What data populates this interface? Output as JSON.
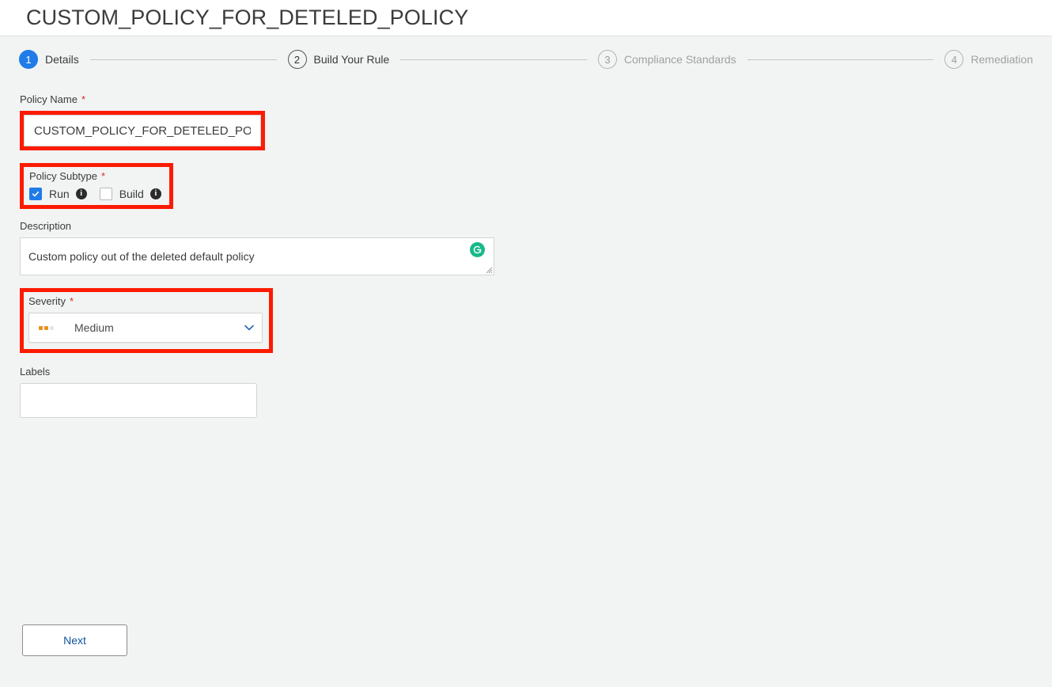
{
  "header": {
    "title": "CUSTOM_POLICY_FOR_DETELED_POLICY"
  },
  "stepper": {
    "steps": [
      {
        "number": "1",
        "label": "Details",
        "state": "active"
      },
      {
        "number": "2",
        "label": "Build Your Rule",
        "state": "current"
      },
      {
        "number": "3",
        "label": "Compliance Standards",
        "state": "inactive"
      },
      {
        "number": "4",
        "label": "Remediation",
        "state": "inactive"
      }
    ]
  },
  "form": {
    "policy_name": {
      "label": "Policy Name",
      "required_marker": "*",
      "value": "CUSTOM_POLICY_FOR_DETELED_POLICY",
      "placeholder": ""
    },
    "policy_subtype": {
      "label": "Policy Subtype",
      "required_marker": "*",
      "options": [
        {
          "label": "Run",
          "checked": true,
          "info": "info-icon"
        },
        {
          "label": "Build",
          "checked": false,
          "info": "info-icon"
        }
      ]
    },
    "description": {
      "label": "Description",
      "value": "Custom policy out of the deleted default policy",
      "placeholder": "",
      "badge_icon": "grammarly-icon"
    },
    "severity": {
      "label": "Severity",
      "required_marker": "*",
      "value": "Medium",
      "dots_filled": 2,
      "dots_total": 3,
      "chevron": "chevron-down-icon"
    },
    "labels": {
      "label": "Labels",
      "value": "",
      "placeholder": ""
    }
  },
  "footer": {
    "next_label": "Next"
  },
  "colors": {
    "accent_blue": "#1f7ce8",
    "highlight_red": "#fc1b00",
    "severity_orange": "#e8921a",
    "grammar_green": "#17b98a",
    "link_blue": "#11539c",
    "page_bg": "#f2f3f3"
  }
}
